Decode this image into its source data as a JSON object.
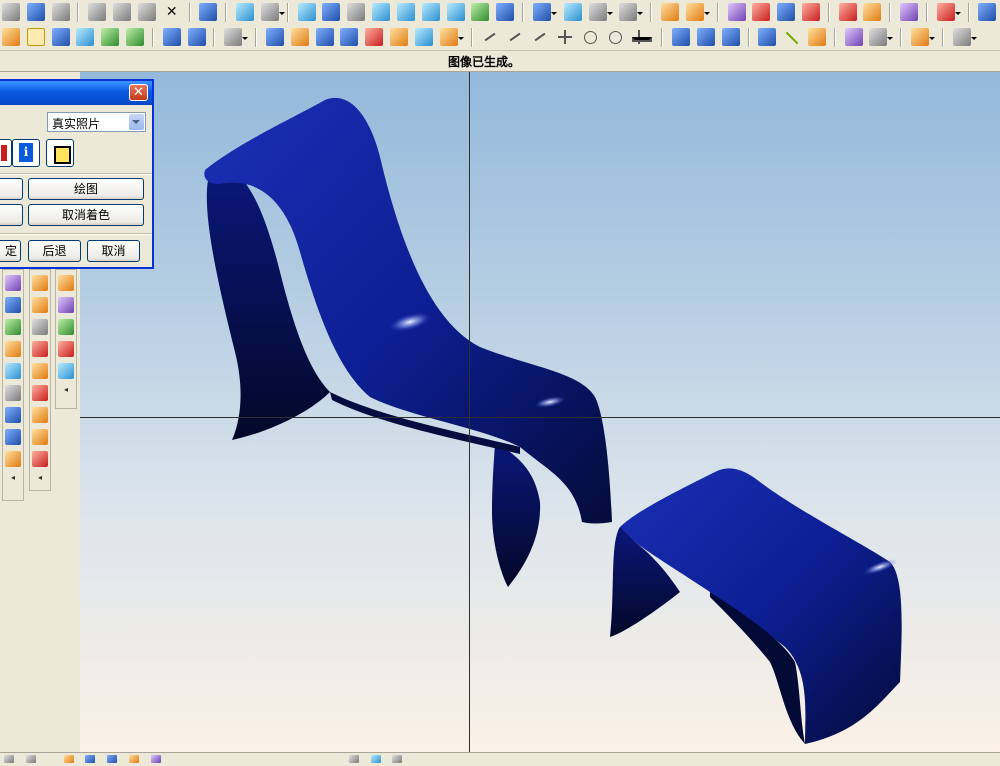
{
  "message_bar": {
    "text": "图像已生成。"
  },
  "dialog": {
    "render_mode": {
      "selected": "真实照片"
    },
    "buttons": {
      "draw": "绘图",
      "uncolor": "取消着色",
      "ok": "定",
      "back": "后退",
      "cancel": "取消"
    },
    "info_icon_label": "i"
  },
  "model": {
    "color": "#0b1f8f",
    "objects": [
      "chaise-lounge",
      "ottoman"
    ]
  },
  "toolbar_top": {
    "icons": [
      "new-file-icon",
      "save-icon",
      "print-icon",
      "cut-icon",
      "copy-icon",
      "paste-icon",
      "delete-icon",
      "undo-icon",
      "regenerate-icon",
      "select-icon",
      "refresh-icon",
      "zoom-fit-icon",
      "shade-icon",
      "zoom-window-icon",
      "zoom-in-icon",
      "rotate-icon",
      "pan-icon",
      "axes-icon",
      "model-tree-icon",
      "view-cube-icon",
      "wireframe-icon",
      "hidden-line-icon",
      "dimension-icon",
      "ruler-icon",
      "hierarchy-icon",
      "layer-icon",
      "surface-icon",
      "curvature-icon",
      "analysis-icon",
      "color-map-icon",
      "spline-icon",
      "draft-icon",
      "feature-icon",
      "assembly-icon",
      "tool-icon",
      "render-icon",
      "camera-icon"
    ]
  },
  "toolbar_second": {
    "icons": [
      "sketch-icon",
      "pointer-icon",
      "extrude-icon",
      "revolve-icon",
      "sweep-icon",
      "blend-icon",
      "shell-icon",
      "round-icon",
      "chamfer-icon",
      "rib-icon",
      "mirror-icon",
      "pattern-icon",
      "line-icon",
      "arc-icon",
      "circle-icon",
      "point-icon",
      "csys-icon",
      "datum-plane-icon",
      "datum-axis-icon",
      "datum-curve-icon",
      "datum-point-icon",
      "offset-icon",
      "trim-icon",
      "merge-icon",
      "intersect-icon",
      "project-icon",
      "wrap-icon"
    ]
  },
  "status_bar": {
    "icons": [
      "view-icon",
      "filter-icon",
      "select-mode-icon",
      "snap-icon",
      "grid-icon",
      "layer-icon",
      "display-icon"
    ]
  }
}
